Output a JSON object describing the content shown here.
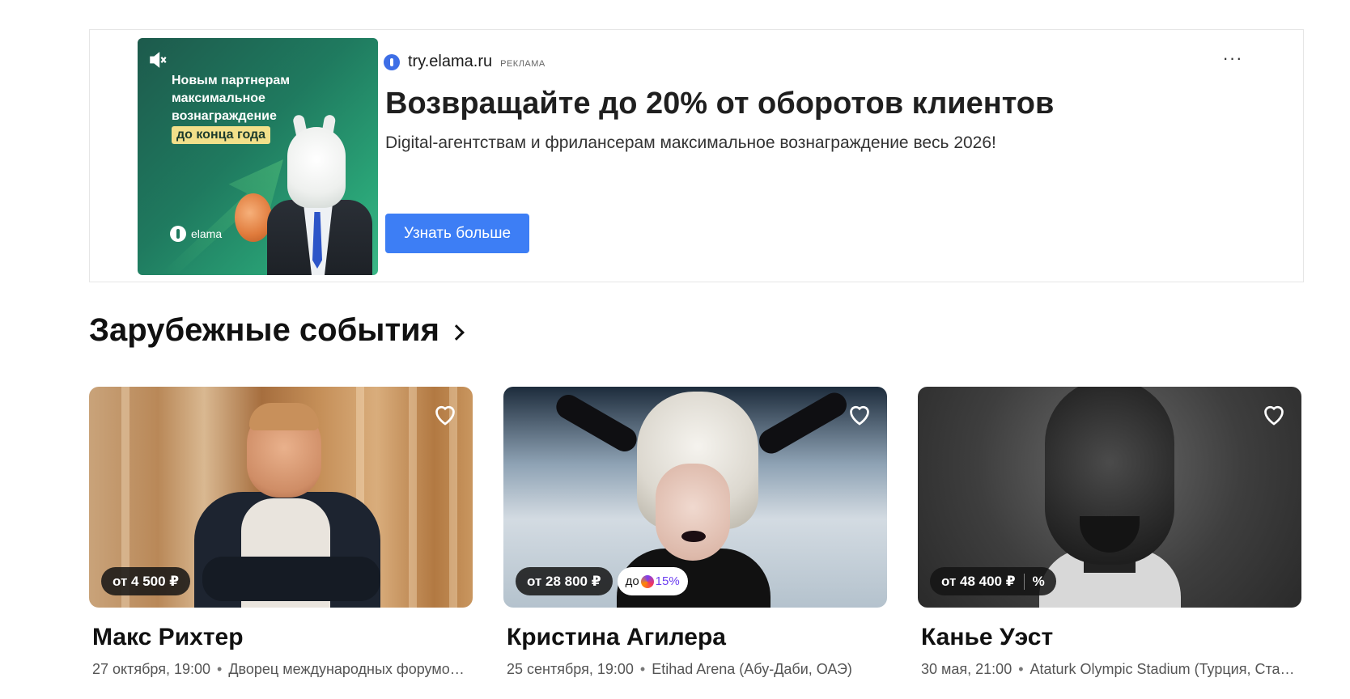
{
  "ad": {
    "image": {
      "promo_line1": "Новым партнерам",
      "promo_line2": "максимальное",
      "promo_line3": "вознаграждение",
      "promo_highlight": "до конца года",
      "brand": "elama",
      "mute_icon": "mute-icon"
    },
    "domain": "try.elama.ru",
    "ad_label": "РЕКЛАМА",
    "more_icon": "more-icon",
    "title": "Возвращайте до 20% от оборотов клиентов",
    "description": "Digital-агентствам и фрилансерам максимальное вознаграждение весь 2026!",
    "button_label": "Узнать больше",
    "button_color": "#3d7ef5"
  },
  "section": {
    "title": "Зарубежные события",
    "chevron_icon": "chevron-right-icon"
  },
  "events": [
    {
      "name": "Макс Рихтер",
      "price": "от 4 500 ₽",
      "date": "27 октября, 19:00",
      "venue": "Дворец международных форумов ..."
    },
    {
      "name": "Кристина Агилера",
      "price": "от 28 800 ₽",
      "cashback_prefix": "до",
      "cashback_value": "15%",
      "date": "25 сентября, 19:00",
      "venue": "Etihad Arena (Абу-Даби, ОАЭ)"
    },
    {
      "name": "Канье Уэст",
      "price": "от 48 400 ₽",
      "discount_sign": "%",
      "date": "30 мая, 21:00",
      "venue": "Ataturk Olympic Stadium (Турция, Стам..."
    }
  ]
}
